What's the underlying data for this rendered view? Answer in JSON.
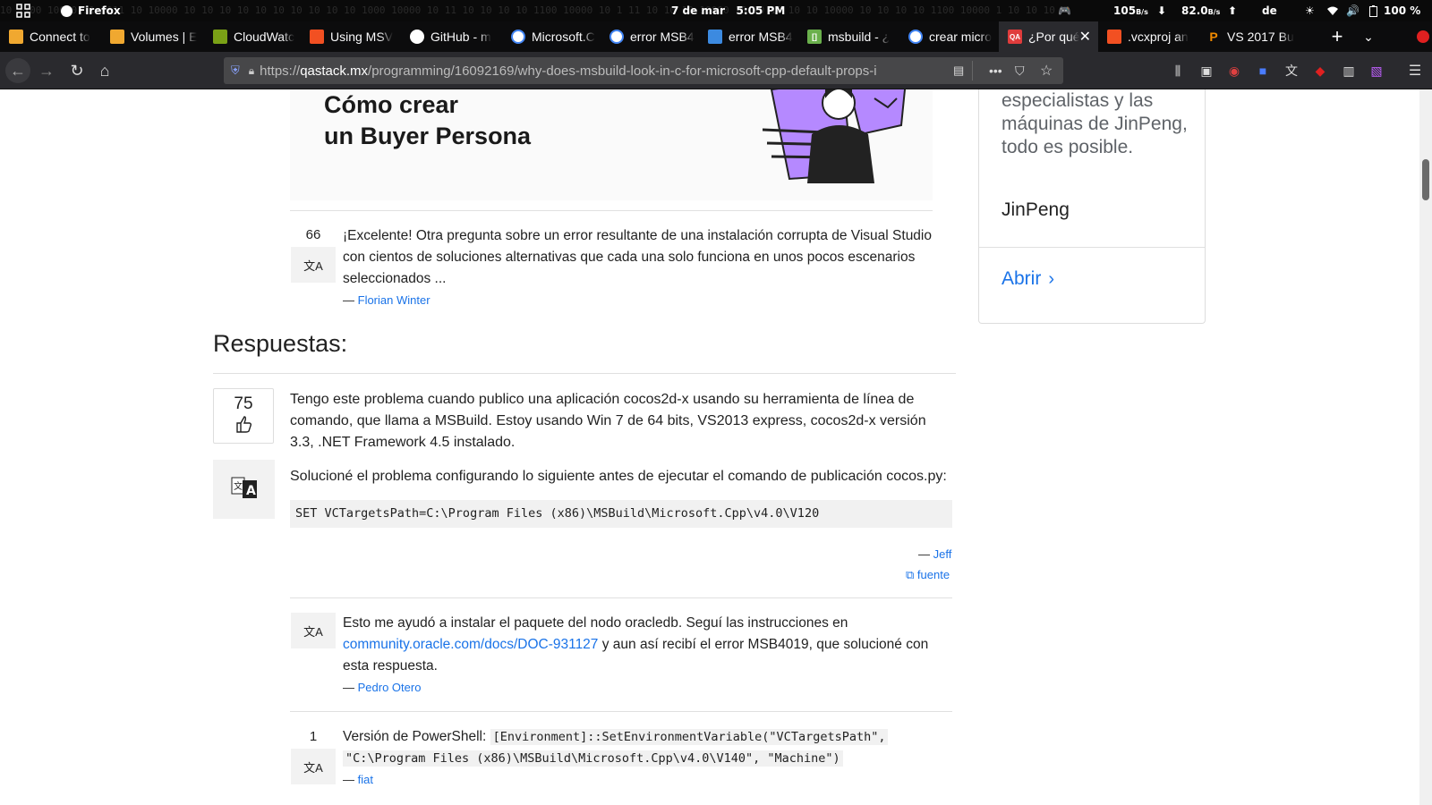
{
  "system_bar": {
    "app": "Firefox",
    "date": "7 de mar",
    "time": "5:05 PM",
    "net_down": "105",
    "net_down_unit": "B/s",
    "net_up": "82.0",
    "net_up_unit": "B/s",
    "keyboard": "de",
    "battery": "100 %",
    "background_text": "10 1100 10000 11 1111 10 10000 10 10 10 10 10 10 10 10 10 10 1000 10000 10 11 10 10 10 10 1100 10000 10 1 11 10 10 10 10000 10 10 10 10 10 10000 10 10 10 10 1100 10000 1 10 10 10"
  },
  "tabs": [
    {
      "title": "Connect to",
      "favicon_color": "#f0a830",
      "favicon": "box-icon"
    },
    {
      "title": "Volumes | E",
      "favicon_color": "#f0a830",
      "favicon": "box-icon"
    },
    {
      "title": "CloudWatc",
      "favicon_color": "#7aa116",
      "favicon": "cloudwatch-icon"
    },
    {
      "title": "Using MSV",
      "favicon_color": "#f25022",
      "favicon": "microsoft-icon"
    },
    {
      "title": "GitHub - m",
      "favicon_color": "#ffffff",
      "favicon": "github-icon"
    },
    {
      "title": "Microsoft.C",
      "favicon_color": "#ffffff",
      "favicon": "google-icon"
    },
    {
      "title": "error MSB4",
      "favicon_color": "#ffffff",
      "favicon": "google-icon"
    },
    {
      "title": "error MSB4",
      "favicon_color": "#3c8ae0",
      "favicon": "vs-icon"
    },
    {
      "title": "msbuild - ¿",
      "favicon_color": "#6ab04c",
      "favicon": "qa-icon"
    },
    {
      "title": "crear micro",
      "favicon_color": "#ffffff",
      "favicon": "google-icon"
    },
    {
      "title": "¿Por qué",
      "favicon_color": "#e03c3c",
      "favicon": "qa-icon",
      "active": true
    },
    {
      "title": ".vcxproj an",
      "favicon_color": "#f25022",
      "favicon": "microsoft-icon"
    },
    {
      "title": "VS 2017 Bu",
      "favicon_color": "#f08a00",
      "favicon": "p-icon"
    }
  ],
  "active_tab_favicon_text": "QA",
  "msbuild_favicon_text": "[]",
  "p_favicon_text": "P",
  "url": {
    "prefix": "https://",
    "domain": "qastack.mx",
    "path": "/programming/16092169/why-does-msbuild-look-in-c-for-microsoft-cpp-default-props-i"
  },
  "banner": {
    "line1": "Cómo crear",
    "line2": "un Buyer Persona"
  },
  "question_comment": {
    "score": "66",
    "text": "¡Excelente! Otra pregunta sobre un error resultante de una instalación corrupta de Visual Studio con cientos de soluciones alternativas que cada una solo funciona en unos pocos escenarios seleccionados ...",
    "author_prefix": "— ",
    "author": "Florian Winter"
  },
  "answers_heading": "Respuestas:",
  "answer": {
    "score": "75",
    "para1": "Tengo este problema cuando publico una aplicación cocos2d-x usando su herramienta de línea de comando, que llama a MSBuild. Estoy usando Win 7 de 64 bits, VS2013 express, cocos2d-x versión 3.3, .NET Framework 4.5 instalado.",
    "para2": "Solucioné el problema configurando lo siguiente antes de ejecutar el comando de publicación cocos.py:",
    "code": "SET VCTargetsPath=C:\\Program Files (x86)\\MSBuild\\Microsoft.Cpp\\v4.0\\V120",
    "author_prefix": "— ",
    "author": "Jeff",
    "source": "fuente"
  },
  "comment1": {
    "text_before": "Esto me ayudó a instalar el paquete del nodo oracledb. Seguí las instrucciones en ",
    "link": "community.oracle.com/docs/DOC-931127",
    "text_after": " y aun así recibí el error MSB4019, que solucioné con esta respuesta.",
    "author_prefix": "— ",
    "author": "Pedro Otero"
  },
  "comment2": {
    "score": "1",
    "text": "Versión de PowerShell: ",
    "code1": "[Environment]::SetEnvironmentVariable(\"VCTargetsPath\",",
    "code2": "\"C:\\Program Files (x86)\\MSBuild\\Microsoft.Cpp\\v4.0\\V140\", \"Machine\")",
    "author_prefix": "— ",
    "author": "fiat"
  },
  "sidebar": {
    "text": "especialistas y las máquinas de JinPeng, todo es posible.",
    "name": "JinPeng",
    "open_label": "Abrir"
  }
}
